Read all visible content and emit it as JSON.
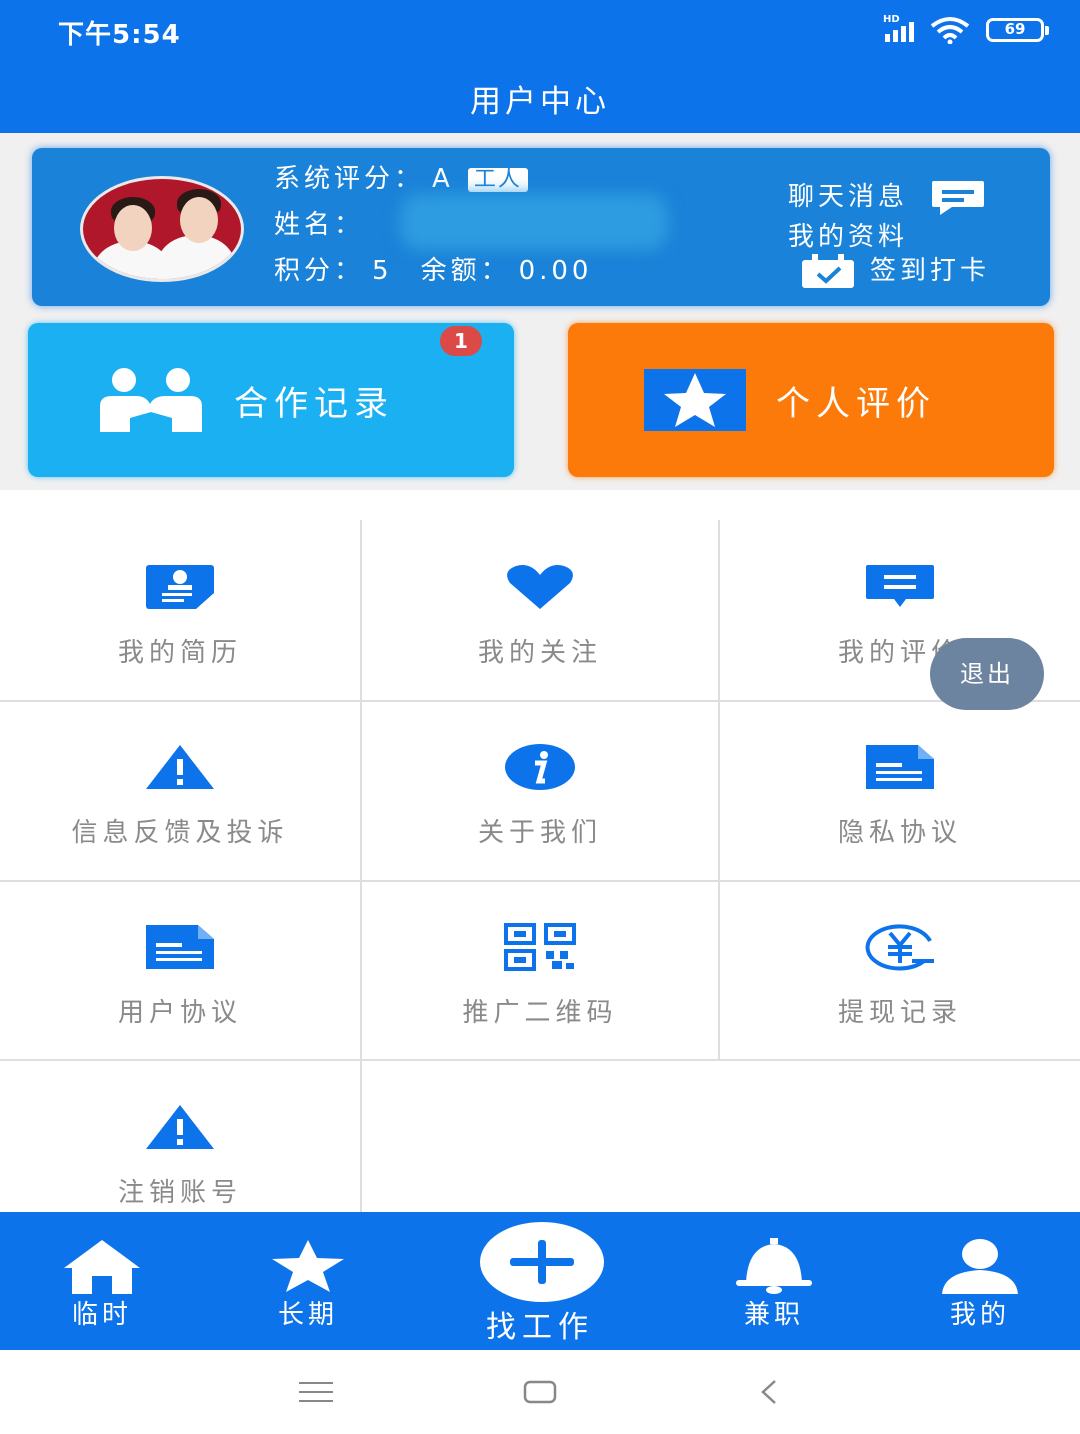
{
  "status_bar": {
    "time": "下午5:54",
    "network": "HD",
    "battery": "69"
  },
  "header": {
    "title": "用户中心"
  },
  "profile": {
    "rating_label": "系统评分：",
    "rating_value": "A",
    "role_badge": "工人",
    "name_label": "姓名：",
    "points_label": "积分：",
    "points_value": "5",
    "balance_label": "余额：",
    "balance_value": "0.00",
    "links": {
      "chat": "聊天消息",
      "my_info": "我的资料",
      "check_in": "签到打卡"
    }
  },
  "actions": {
    "cooperation": {
      "label": "合作记录",
      "badge": "1"
    },
    "evaluation": {
      "label": "个人评价"
    }
  },
  "grid": [
    {
      "label": "我的简历",
      "icon": "resume-icon"
    },
    {
      "label": "我的关注",
      "icon": "heart-icon"
    },
    {
      "label": "我的评价",
      "icon": "comment-icon"
    },
    {
      "label": "信息反馈及投诉",
      "icon": "warning-icon"
    },
    {
      "label": "关于我们",
      "icon": "info-icon"
    },
    {
      "label": "隐私协议",
      "icon": "document-icon"
    },
    {
      "label": "用户协议",
      "icon": "document-icon"
    },
    {
      "label": "推广二维码",
      "icon": "qrcode-icon"
    },
    {
      "label": "提现记录",
      "icon": "yuan-icon"
    },
    {
      "label": "注销账号",
      "icon": "warning-icon"
    }
  ],
  "floating": {
    "logout": "退出"
  },
  "bottom_nav": [
    {
      "label": "临时",
      "icon": "home-icon"
    },
    {
      "label": "长期",
      "icon": "star-icon"
    },
    {
      "label": "找工作",
      "icon": "plus-icon"
    },
    {
      "label": "兼职",
      "icon": "bell-icon"
    },
    {
      "label": "我的",
      "icon": "user-icon"
    }
  ],
  "colors": {
    "primary": "#0d73ea",
    "card": "#1a82d8",
    "cooperation": "#1ab0f2",
    "evaluation": "#fb7a09",
    "badge": "#dc4a48"
  }
}
